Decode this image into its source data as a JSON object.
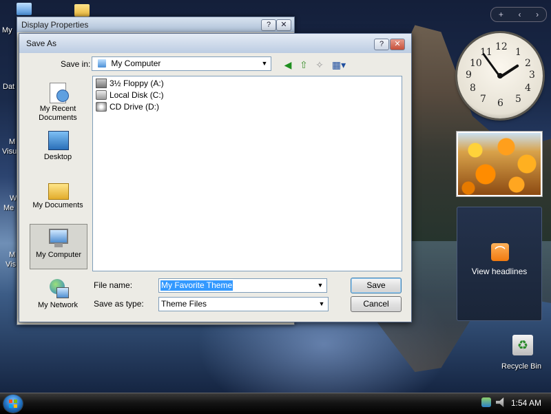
{
  "desktop": {
    "icon_fragments": [
      "My",
      "Dat",
      "M",
      "Visu",
      "W",
      "Me",
      "M",
      "Vis"
    ],
    "recycle_bin_label": "Recycle Bin"
  },
  "display_properties": {
    "title": "Display Properties",
    "help_label": "?",
    "close_label": "✕"
  },
  "save_as": {
    "title": "Save As",
    "help_label": "?",
    "close_label": "✕",
    "save_in_label": "Save in:",
    "save_in_value": "My Computer",
    "places": [
      {
        "label": "My Recent Documents"
      },
      {
        "label": "Desktop"
      },
      {
        "label": "My Documents"
      },
      {
        "label": "My Computer"
      },
      {
        "label": "My Network"
      }
    ],
    "files": [
      {
        "name": "3½ Floppy (A:)",
        "icon": "floppy-drive-icon"
      },
      {
        "name": "Local Disk (C:)",
        "icon": "hard-disk-icon"
      },
      {
        "name": "CD Drive (D:)",
        "icon": "cd-drive-icon"
      }
    ],
    "file_name_label": "File name:",
    "file_name_value": "My Favorite Theme",
    "save_as_type_label": "Save as type:",
    "save_as_type_value": "Theme Files",
    "save_button": "Save",
    "cancel_button": "Cancel"
  },
  "sidebar": {
    "add_label": "+",
    "prev_label": "‹",
    "next_label": "›",
    "clock_numbers": [
      "12",
      "1",
      "2",
      "3",
      "4",
      "5",
      "6",
      "7",
      "8",
      "9",
      "10",
      "11"
    ],
    "feeds_label": "View headlines"
  },
  "taskbar": {
    "time": "1:54 AM"
  }
}
